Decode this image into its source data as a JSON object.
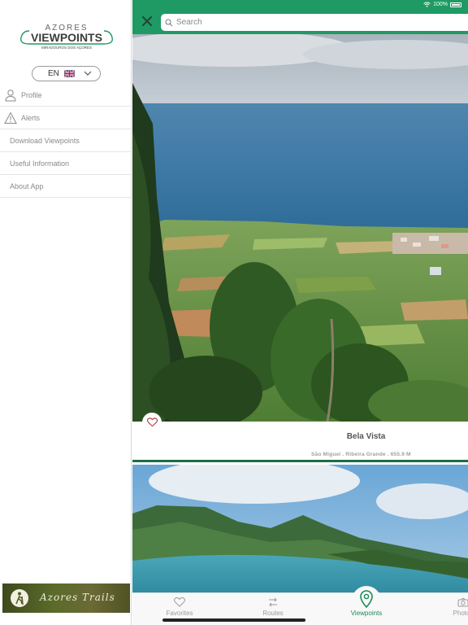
{
  "drawer": {
    "logo_top": "AZORES",
    "logo_main": "VIEWPOINTS",
    "logo_sub": "MIRADOUROS DOS AÇORES",
    "language": "EN",
    "menu": [
      {
        "label": "Profile",
        "icon": "person-icon"
      },
      {
        "label": "Alerts",
        "icon": "warning-icon"
      },
      {
        "label": "Download Viewpoints"
      },
      {
        "label": "Useful Information"
      },
      {
        "label": "About App"
      }
    ],
    "banner_text": "Azores Trails"
  },
  "status": {
    "battery": "100%"
  },
  "search": {
    "placeholder": "Search"
  },
  "cards": [
    {
      "title": "Bela Vista",
      "subtitle": "São Miguel . Ribeira Grande . 655.9 M"
    }
  ],
  "tabs": [
    {
      "label": "Favorites",
      "icon": "heart-icon"
    },
    {
      "label": "Routes",
      "icon": "routes-icon"
    },
    {
      "label": "Viewpoints",
      "icon": "location-pin-icon",
      "active": true
    },
    {
      "label": "Photos",
      "icon": "camera-icon"
    }
  ],
  "colors": {
    "brand_green": "#1f9a64",
    "dark_green": "#1b6e44",
    "active_tab": "#1b8a5a"
  }
}
